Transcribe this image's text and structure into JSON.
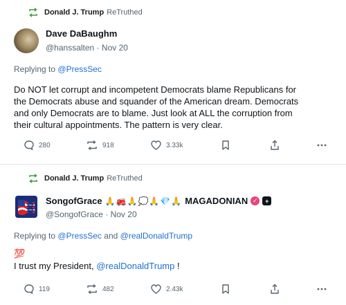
{
  "colors": {
    "accent_link": "#1f6fd1",
    "retruth_green": "#3aa13a",
    "verified_pink": "#e8457a"
  },
  "posts": [
    {
      "retruth_user": "Donald J. Trump",
      "retruth_label": "ReTruthed",
      "author_name": "Dave DaBaughm",
      "author_handle": "@hanssalten",
      "separator": "·",
      "date": "Nov 20",
      "replying_prefix": "Replying to",
      "replying_to": "@PressSec",
      "text_lines": [
        "Do NOT let corrupt and incompetent Democrats blame Republicans for",
        "the Democrats abuse and squander of the American dream.  Democrats",
        "and only Democrats are to blame.  Just look at ALL the corruption from",
        "their cultural appointments.  The pattern is very clear."
      ],
      "replies": "280",
      "retruths": "918",
      "likes": "3.33k"
    },
    {
      "retruth_user": "Donald J. Trump",
      "retruth_label": "ReTruthed",
      "author_name": "SongofGrace",
      "author_name_emojis": "🙏🚒🙏💭🙏💎🙏",
      "author_name_suffix": "MAGADONIAN",
      "author_handle": "@SongofGrace",
      "separator": "·",
      "date": "Nov 20",
      "replying_prefix": "Replying to",
      "replying_to": "@PressSec",
      "replying_and": "and",
      "replying_to_2": "@realDonaldTrump",
      "emoji_line": "💯",
      "text_prefix": "I trust my President,",
      "text_mention": "@realDonaldTrump",
      "text_suffix": "!",
      "replies": "119",
      "retruths": "482",
      "likes": "2.43k"
    }
  ]
}
